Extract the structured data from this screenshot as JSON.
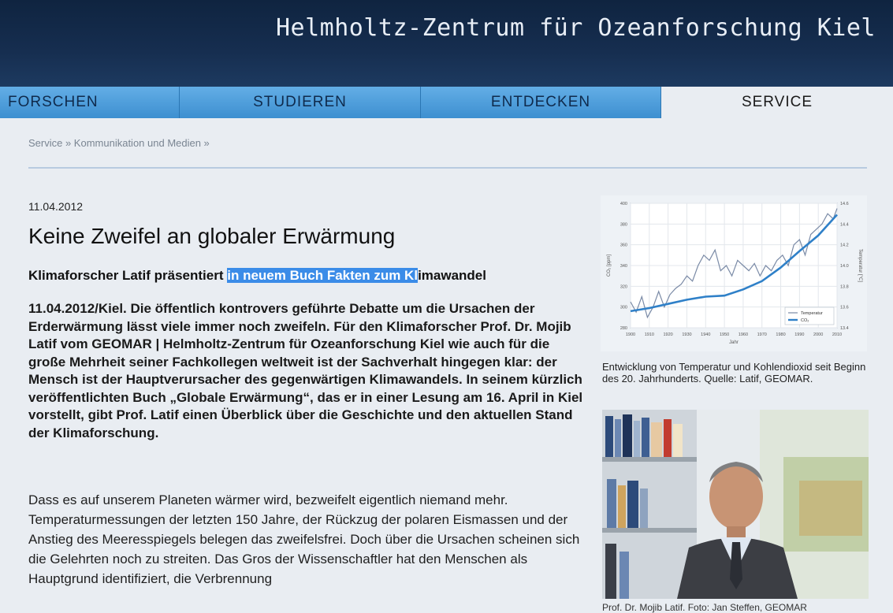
{
  "header": {
    "title": "Helmholtz-Zentrum für Ozeanforschung Kiel"
  },
  "nav": {
    "items": [
      "FORSCHEN",
      "STUDIEREN",
      "ENTDECKEN",
      "SERVICE"
    ],
    "active": "SERVICE"
  },
  "breadcrumb": "Service » Kommunikation und Medien »",
  "article": {
    "date": "11.04.2012",
    "headline": "Keine Zweifel an globaler Erwärmung",
    "subline_before": "Klimaforscher Latif präsentiert ",
    "subline_highlight": "in neuem Buch Fakten zum Kl",
    "subline_after": "imawandel",
    "lead": "11.04.2012/Kiel. Die öffentlich kontrovers geführte Debatte um die Ursachen der Erderwärmung lässt viele immer noch zweifeln. Für den Klimaforscher Prof. Dr. Mojib Latif vom GEOMAR | Helmholtz-Zentrum für Ozeanforschung Kiel wie auch für die große Mehrheit seiner Fachkollegen weltweit ist der Sachverhalt hingegen klar: der Mensch ist der Hauptverursacher des gegenwärtigen Klimawandels. In seinem kürzlich veröffentlichten Buch „Globale Erwärmung“, das er in einer Lesung am 16. April in Kiel vorstellt, gibt Prof. Latif einen Überblick über die Geschichte und den aktuellen Stand der Klimaforschung.",
    "body": "Dass es auf unserem Planeten wärmer wird, bezweifelt eigentlich niemand mehr. Temperaturmessungen der letzten 150 Jahre, der Rückzug der polaren Eismassen und der Anstieg des Meeresspiegels belegen das zweifelsfrei. Doch über die Ursachen scheinen sich die Gelehrten noch zu streiten. Das Gros der Wissenschaftler hat den Menschen als Hauptgrund identifiziert, die Verbrennung"
  },
  "sidebar": {
    "chart_caption": "Entwicklung von Temperatur und Kohlendioxid seit Beginn des 20. Jahrhunderts. Quelle: Latif, GEOMAR.",
    "photo_caption": "Prof. Dr. Mojib Latif. Foto: Jan Steffen, GEOMAR"
  },
  "chart_data": {
    "type": "line",
    "xlabel": "Jahr",
    "ylabel_left": "CO₂ [ppm]",
    "ylabel_right": "Temperatur [°C]",
    "x_ticks": [
      1900,
      1910,
      1920,
      1930,
      1940,
      1950,
      1960,
      1970,
      1980,
      1990,
      2000,
      2010
    ],
    "y_left_ticks": [
      280,
      300,
      320,
      340,
      360,
      380,
      400
    ],
    "y_right_ticks": [
      13.4,
      13.6,
      13.8,
      14.0,
      14.2,
      14.4,
      14.6
    ],
    "xlim": [
      1900,
      2010
    ],
    "ylim_left": [
      280,
      400
    ],
    "ylim_right": [
      13.4,
      14.6
    ],
    "legend": {
      "position": "bottom-right",
      "entries": [
        "Temperatur",
        "CO₂"
      ]
    },
    "series": [
      {
        "name": "Temperatur",
        "axis": "right",
        "color": "#7a8aa6",
        "x": [
          1900,
          1903,
          1906,
          1909,
          1912,
          1915,
          1918,
          1921,
          1924,
          1927,
          1930,
          1933,
          1936,
          1939,
          1942,
          1945,
          1948,
          1951,
          1954,
          1957,
          1960,
          1963,
          1966,
          1969,
          1972,
          1975,
          1978,
          1981,
          1984,
          1987,
          1990,
          1993,
          1996,
          1999,
          2002,
          2005,
          2008,
          2010
        ],
        "values": [
          13.65,
          13.55,
          13.7,
          13.5,
          13.6,
          13.75,
          13.6,
          13.72,
          13.78,
          13.82,
          13.9,
          13.85,
          14.0,
          14.1,
          14.05,
          14.15,
          13.95,
          14.0,
          13.9,
          14.05,
          14.0,
          13.95,
          14.02,
          13.9,
          14.0,
          13.95,
          14.05,
          14.1,
          14.0,
          14.2,
          14.25,
          14.1,
          14.3,
          14.35,
          14.4,
          14.5,
          14.45,
          14.55
        ]
      },
      {
        "name": "CO₂",
        "axis": "left",
        "color": "#2f80c8",
        "x": [
          1900,
          1910,
          1920,
          1930,
          1940,
          1950,
          1960,
          1970,
          1980,
          1990,
          2000,
          2010
        ],
        "values": [
          296,
          299,
          303,
          307,
          310,
          311,
          317,
          325,
          338,
          354,
          369,
          389
        ]
      }
    ]
  },
  "colors": {
    "header_bg": "#142a48",
    "nav_blue": "#4a9bdb",
    "highlight": "#3b8ce8"
  }
}
